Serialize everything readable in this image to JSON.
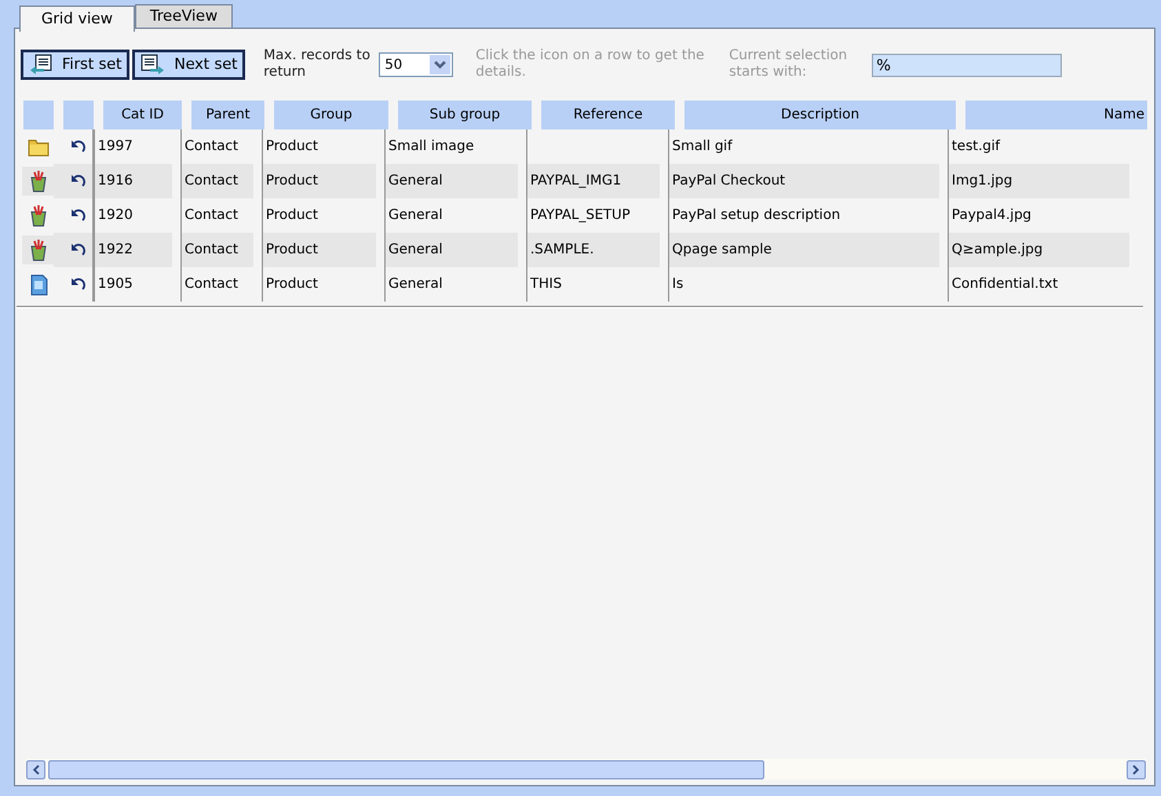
{
  "tabs": [
    {
      "label": "Grid view",
      "selected": true
    },
    {
      "label": "TreeView",
      "selected": false
    }
  ],
  "toolbar": {
    "first_button": "First set",
    "next_button": "Next set",
    "max_label": "Max. records to return",
    "max_value": "50",
    "hint": "Click the icon on a row to get the details.",
    "selection_label": "Current selection starts with:",
    "selection_value": "%"
  },
  "table": {
    "columns": [
      "Cat ID",
      "Parent",
      "Group",
      "Sub group",
      "Reference",
      "Description",
      "Name"
    ],
    "rows": [
      {
        "kind": "folder",
        "cells": [
          "1997",
          "Contact",
          "Product",
          "Small image",
          "",
          "Small gif",
          "test.gif"
        ]
      },
      {
        "kind": "image",
        "cells": [
          "1916",
          "Contact",
          "Product",
          "General",
          "PAYPAL_IMG1",
          "PayPal Checkout",
          "Img1.jpg"
        ]
      },
      {
        "kind": "image",
        "cells": [
          "1920",
          "Contact",
          "Product",
          "General",
          "PAYPAL_SETUP",
          "PayPal setup description",
          "Paypal4.jpg"
        ]
      },
      {
        "kind": "image",
        "cells": [
          "1922",
          "Contact",
          "Product",
          "General",
          ".SAMPLE.",
          "Qpage sample",
          "Q≥ample.jpg"
        ]
      },
      {
        "kind": "document",
        "cells": [
          "1905",
          "Contact",
          "Product",
          "General",
          "THIS",
          "Is",
          "Confidential.txt"
        ]
      }
    ]
  }
}
